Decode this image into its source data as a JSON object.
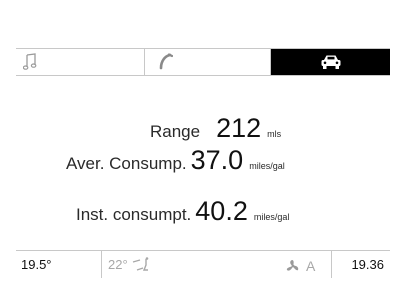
{
  "tabs": [
    {
      "name": "audio",
      "icon": "music-note-icon",
      "active": false
    },
    {
      "name": "phone",
      "icon": "phone-handset-icon",
      "active": false
    },
    {
      "name": "vehicle",
      "icon": "car-icon",
      "active": true
    }
  ],
  "trip": {
    "range": {
      "label": "Range",
      "value": "212",
      "unit": "mls"
    },
    "average": {
      "label": "Aver. Consump.",
      "value": "37.0",
      "unit": "miles/gal"
    },
    "instant": {
      "label": "Inst. consumpt.",
      "value": "40.2",
      "unit": "miles/gal"
    }
  },
  "status": {
    "outside_temp": "19.5°",
    "set_temp": "22°",
    "airflow_icon": "air-distribution-icon",
    "fan_icon": "fan-icon",
    "fan_mode": "A",
    "clock": "19.36"
  },
  "colors": {
    "active_tab_bg": "#000000",
    "divider": "#c8c8c8",
    "inactive_text": "#a8a8a8"
  }
}
